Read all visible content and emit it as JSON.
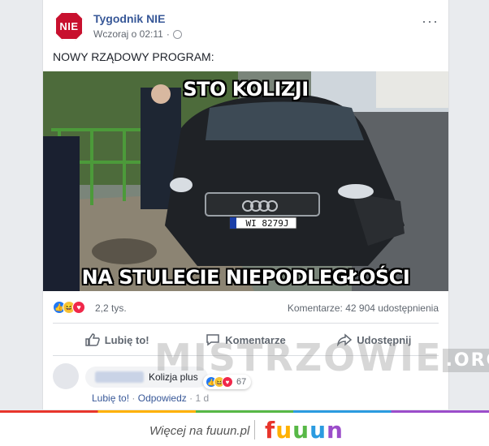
{
  "post": {
    "page_name": "Tygodnik NIE",
    "avatar_text": "NIE",
    "timestamp": "Wczoraj o 02:11",
    "more": "···",
    "caption": "NOWY RZĄDOWY PROGRAM:",
    "meme_top": "STO KOLIZJI",
    "meme_bottom": "NA STULECIE NIEPODLEGŁOŚCI",
    "plate": "WI 8279J",
    "reaction_count": "2,2 tys.",
    "comments_shares": "Komentarze: 42  904 udostępnienia"
  },
  "actions": {
    "like": "Lubię to!",
    "comment": "Komentarze",
    "share": "Udostępnij"
  },
  "watermark": {
    "text": "MISTRZOWIE",
    "suffix": ".ORG"
  },
  "comment": {
    "text": "Kolizja plus",
    "reaction_count": "67",
    "like": "Lubię to!",
    "reply": "Odpowiedz",
    "time": "1 d"
  },
  "footer": {
    "text": "Więcej na fuuun.pl",
    "logo": [
      "f",
      "u",
      "u",
      "u",
      "n"
    ]
  },
  "colors": {
    "link": "#385898",
    "stop_sign": "#c8102e"
  }
}
